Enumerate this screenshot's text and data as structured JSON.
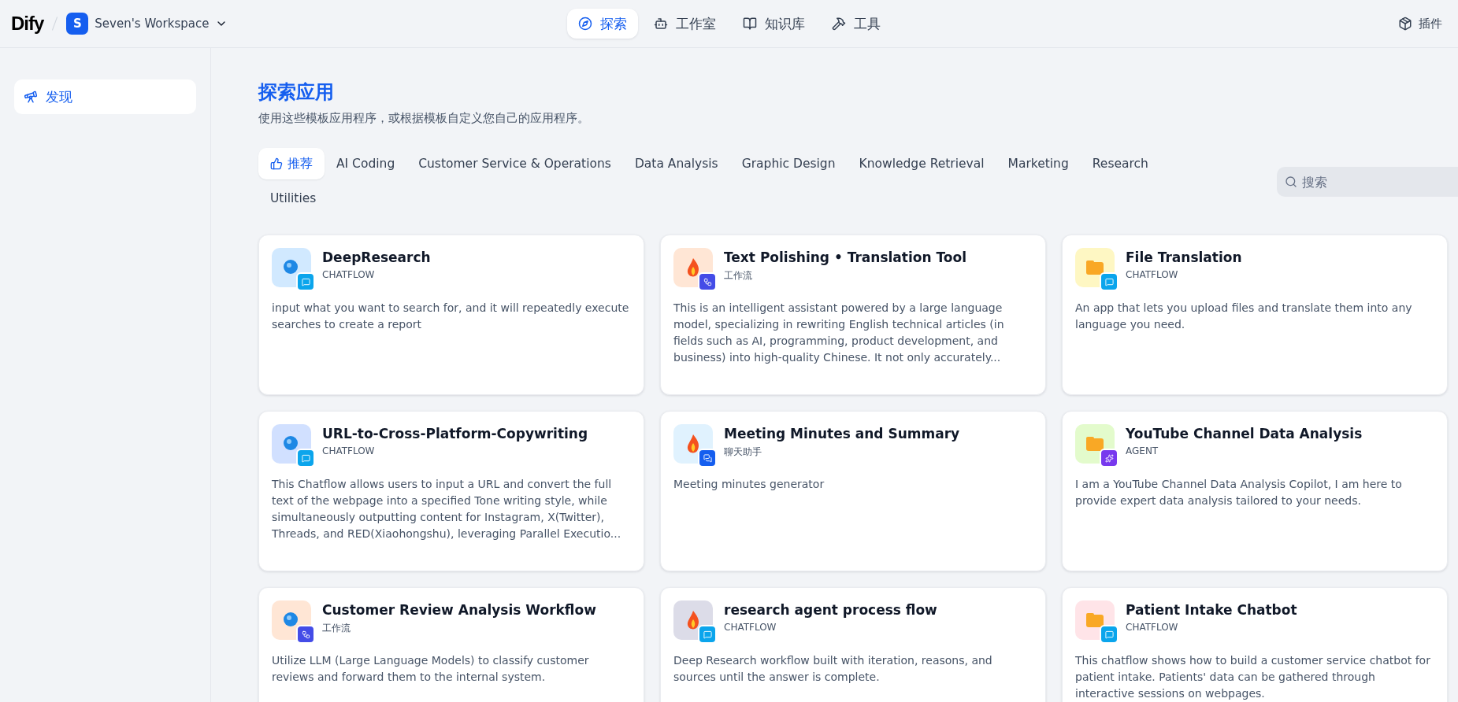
{
  "header": {
    "logo": "Dify",
    "workspace": {
      "initial": "S",
      "name": "Seven's Workspace"
    },
    "nav": [
      {
        "label": "探索",
        "kind": "explore",
        "selected": true
      },
      {
        "label": "工作室",
        "kind": "studio",
        "selected": false
      },
      {
        "label": "知识库",
        "kind": "knowledge",
        "selected": false
      },
      {
        "label": "工具",
        "kind": "tools",
        "selected": false
      }
    ],
    "plugins": "插件"
  },
  "sidebar": {
    "items": [
      {
        "label": "发现",
        "selected": true
      }
    ]
  },
  "page": {
    "title": "探索应用",
    "subtitle": "使用这些模板应用程序，或根据模板自定义您自己的应用程序。"
  },
  "categories": [
    {
      "label": "推荐",
      "selected": true,
      "kind": "recommended"
    },
    {
      "label": "AI Coding",
      "selected": false,
      "kind": "plain"
    },
    {
      "label": "Customer Service & Operations",
      "selected": false,
      "kind": "plain"
    },
    {
      "label": "Data Analysis",
      "selected": false,
      "kind": "plain"
    },
    {
      "label": "Graphic Design",
      "selected": false,
      "kind": "plain"
    },
    {
      "label": "Knowledge Retrieval",
      "selected": false,
      "kind": "plain"
    },
    {
      "label": "Marketing",
      "selected": false,
      "kind": "plain"
    },
    {
      "label": "Research",
      "selected": false,
      "kind": "plain"
    },
    {
      "label": "Utilities",
      "selected": false,
      "kind": "plain"
    }
  ],
  "search": {
    "placeholder": "搜索"
  },
  "apps": [
    {
      "name": "DeepResearch",
      "mode": "CHATFLOW",
      "kind": "chatflow",
      "color": "#d1e9ff",
      "description": "input what you want to search for, and it will repeatedly execute searches to create a report"
    },
    {
      "name": "Text Polishing • Translation Tool",
      "mode": "工作流",
      "kind": "workflow",
      "color": "#ffe6d5",
      "description": "This is an intelligent assistant powered by a large language model, specializing in rewriting English technical articles (in fields such as AI, programming, product development, and business) into high-quality Chinese. It not only accurately..."
    },
    {
      "name": "File Translation",
      "mode": "CHATFLOW",
      "kind": "chatflow",
      "color": "#fef7c3",
      "description": "An app that lets you upload files and translate them into any language you need."
    },
    {
      "name": "URL-to-Cross-Platform-Copywriting",
      "mode": "CHATFLOW",
      "kind": "chatflow",
      "color": "#d1e0ff",
      "description": "This Chatflow allows users to input a URL and convert the full text of the webpage into a specified Tone writing style, while simultaneously outputting content for Instagram, X(Twitter), Threads, and RED(Xiaohongshu), leveraging Parallel Executio..."
    },
    {
      "name": "Meeting Minutes and Summary",
      "mode": "聊天助手",
      "kind": "chat",
      "color": "#e0f2fe",
      "description": "Meeting minutes generator"
    },
    {
      "name": "YouTube Channel Data Analysis",
      "mode": "AGENT",
      "kind": "agent",
      "color": "#e3fbcc",
      "description": "I am a YouTube Channel Data Analysis Copilot, I am here to provide expert data analysis tailored to your needs."
    },
    {
      "name": "Customer Review Analysis Workflow",
      "mode": "工作流",
      "kind": "workflow",
      "color": "#ffe6d5",
      "description": "Utilize LLM (Large Language Models) to classify customer reviews and forward them to the internal system."
    },
    {
      "name": "research agent process flow",
      "mode": "CHATFLOW",
      "kind": "chatflow",
      "color": "#dcdce8",
      "description": "Deep Research workflow built with iteration, reasons, and sources until the answer is complete."
    },
    {
      "name": "Patient Intake Chatbot",
      "mode": "CHATFLOW",
      "kind": "chatflow",
      "color": "#ffe4e8",
      "description": "This chatflow shows how to build a customer service chatbot for patient intake. Patients' data can be gathered through interactive sessions on webpages."
    }
  ]
}
